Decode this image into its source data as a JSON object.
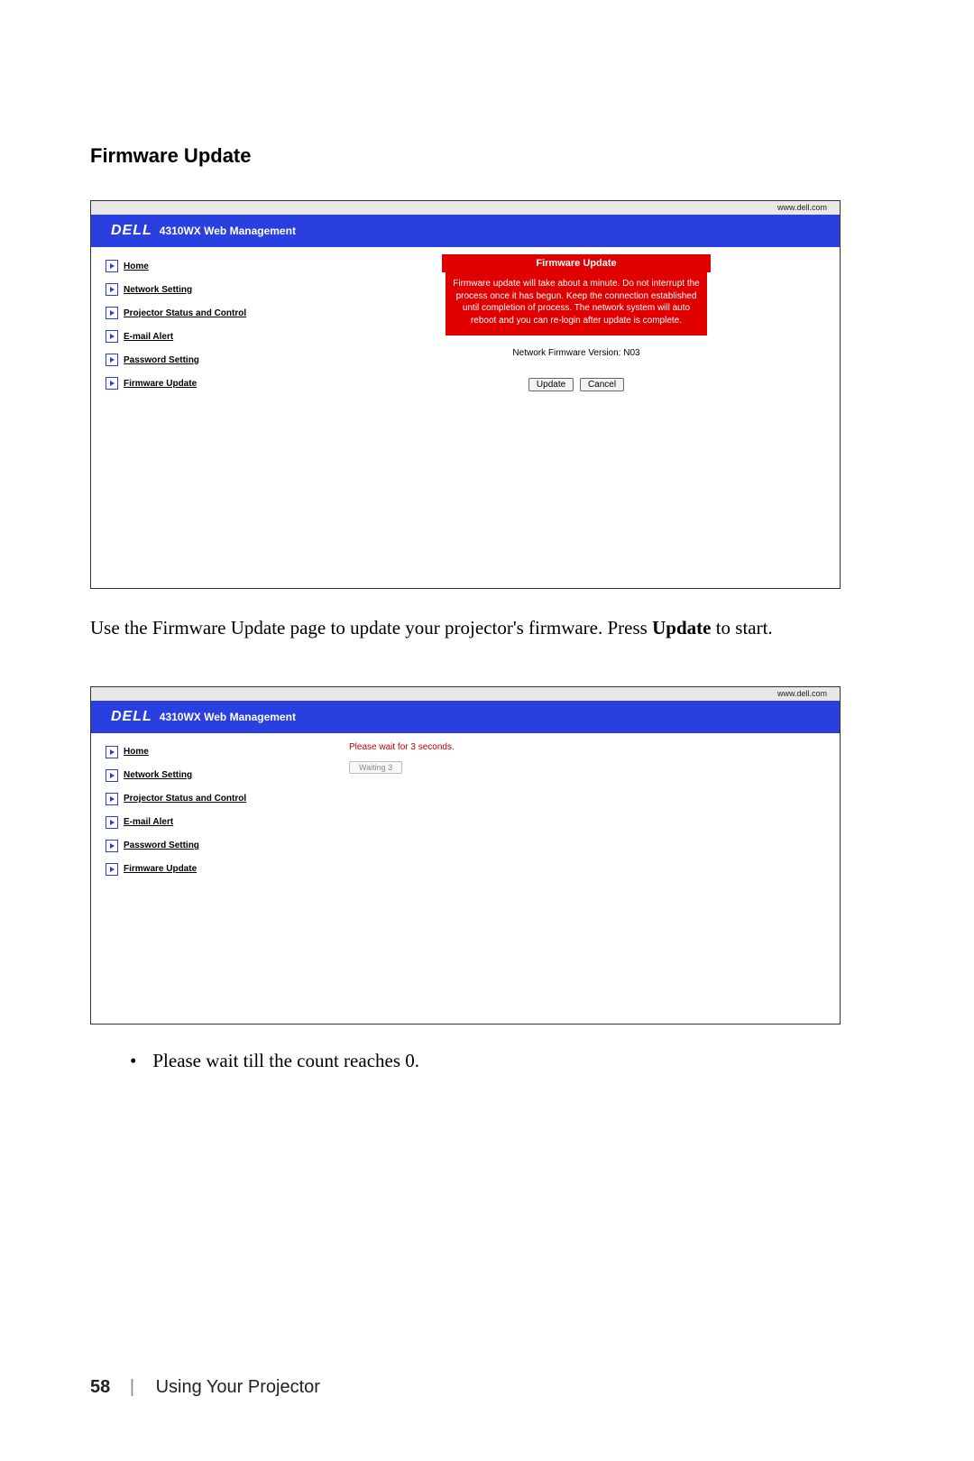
{
  "doc": {
    "section_heading": "Firmware Update",
    "caption1_a": "Use the Firmware Update page to update your projector's firmware. Press ",
    "caption1_b": "Update",
    "caption1_c": " to start.",
    "bullet1": "Please wait till the count reaches 0.",
    "page_number": "58",
    "separator": "|",
    "footer_title": "Using Your Projector"
  },
  "screenshot_a": {
    "url_label": "www.dell.com",
    "logo": "DELL",
    "header_title": "4310WX Web Management",
    "nav": [
      "Home",
      "Network Setting",
      "Projector Status and Control",
      "E-mail Alert",
      "Password Setting",
      "Firmware Update"
    ],
    "red_header": "Firmware Update",
    "red_body": "Firmware update will take about a minute. Do not interrupt the process once it has begun. Keep the connection established until completion of process. The network system will auto reboot and you can re-login after update is complete.",
    "version_line": "Network Firmware Version: N03",
    "btn_update": "Update",
    "btn_cancel": "Cancel"
  },
  "screenshot_b": {
    "url_label": "www.dell.com",
    "logo": "DELL",
    "header_title": "4310WX Web Management",
    "nav": [
      "Home",
      "Network Setting",
      "Projector Status and Control",
      "E-mail Alert",
      "Password Setting",
      "Firmware Update"
    ],
    "wait_text": "Please wait for 3 seconds.",
    "waiting_label": "Waiting 3"
  }
}
